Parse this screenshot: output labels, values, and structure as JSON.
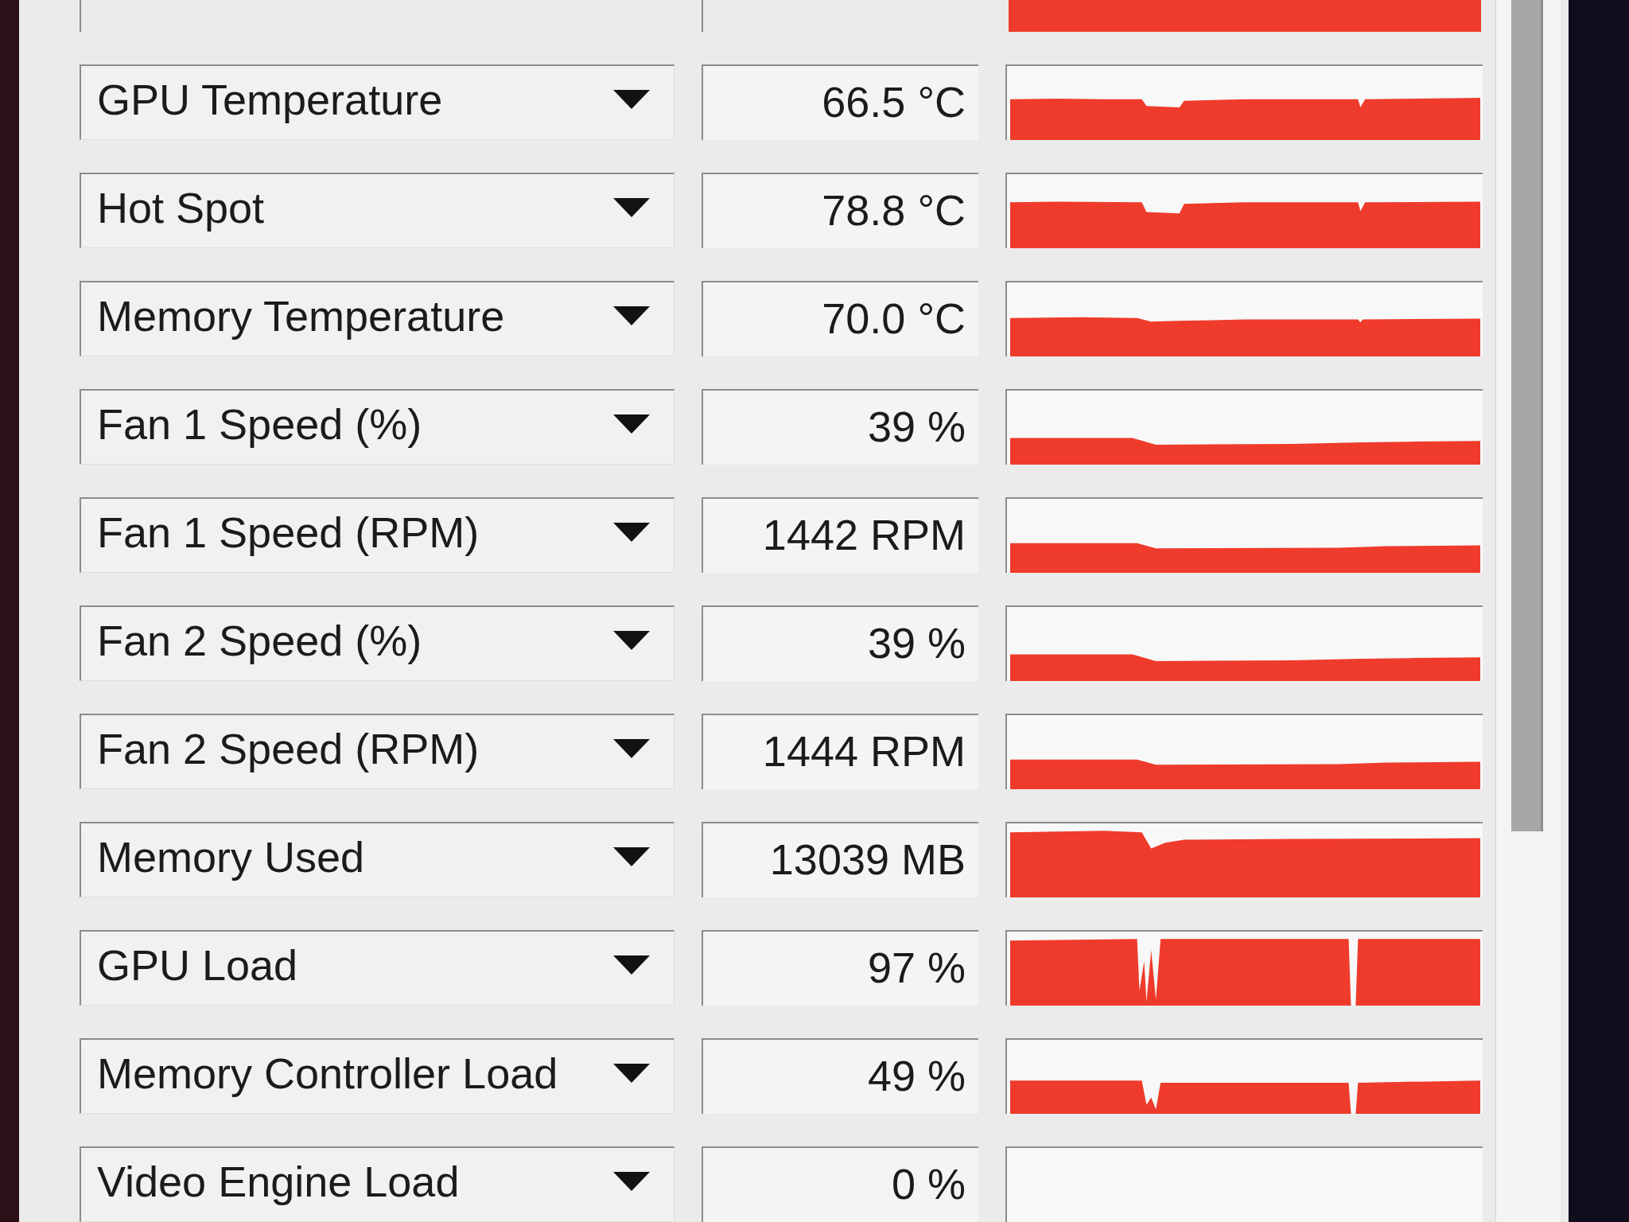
{
  "sensors": [
    {
      "name": "GPU Temperature",
      "reading": "66.5 °C"
    },
    {
      "name": "Hot Spot",
      "reading": "78.8 °C"
    },
    {
      "name": "Memory Temperature",
      "reading": "70.0 °C"
    },
    {
      "name": "Fan 1 Speed (%)",
      "reading": "39 %"
    },
    {
      "name": "Fan 1 Speed (RPM)",
      "reading": "1442 RPM"
    },
    {
      "name": "Fan 2 Speed (%)",
      "reading": "39 %"
    },
    {
      "name": "Fan 2 Speed (RPM)",
      "reading": "1444 RPM"
    },
    {
      "name": "Memory Used",
      "reading": "13039 MB"
    },
    {
      "name": "GPU Load",
      "reading": "97 %"
    },
    {
      "name": "Memory Controller Load",
      "reading": "49 %"
    },
    {
      "name": "Video Engine Load",
      "reading": "0 %"
    }
  ]
}
